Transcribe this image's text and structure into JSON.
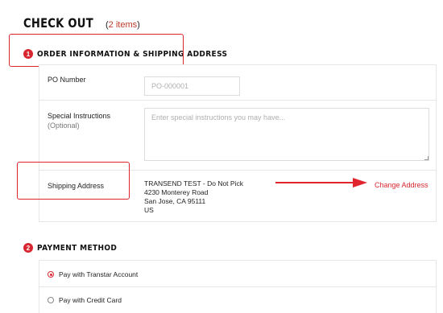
{
  "page": {
    "title": "CHECK OUT",
    "items_count": "2 items"
  },
  "order_section": {
    "step": "1",
    "title": "ORDER INFORMATION & SHIPPING ADDRESS",
    "po_label": "PO Number",
    "po_placeholder": "PO-000001",
    "instructions_label": "Special Instructions",
    "instructions_sub": "(Optional)",
    "instructions_placeholder": "Enter special instructions you may have...",
    "shipping_label": "Shipping Address",
    "address_lines": [
      "TRANSEND TEST - Do Not Pick",
      "4230 Monterey Road",
      "San Jose, CA 95111",
      "US"
    ],
    "change_address": "Change Address"
  },
  "payment_section": {
    "step": "2",
    "title": "PAYMENT METHOD",
    "options": [
      {
        "label": "Pay with Transtar Account",
        "selected": true
      },
      {
        "label": "Pay with Credit Card",
        "selected": false
      }
    ]
  },
  "colors": {
    "accent": "#d7262f",
    "annotation": "#e0252e",
    "border": "#e6e6e6"
  }
}
